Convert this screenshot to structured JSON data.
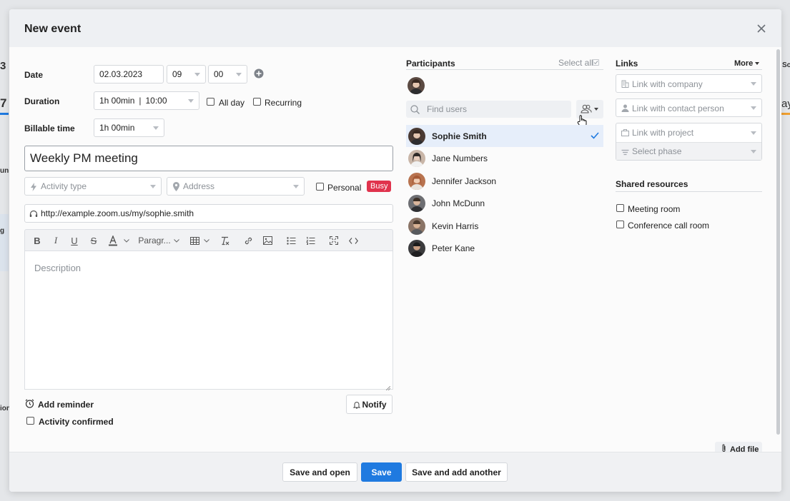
{
  "background": {
    "fragments": [
      "3",
      "7",
      "uni",
      "g",
      "ion",
      "Sc",
      "ay"
    ]
  },
  "modal": {
    "title": "New event"
  },
  "form": {
    "date_label": "Date",
    "date_value": "02.03.2023",
    "hour_value": "09",
    "minute_value": "00",
    "duration_label": "Duration",
    "duration_value": "1h 00min",
    "duration_end": "10:00",
    "all_day_label": "All day",
    "recurring_label": "Recurring",
    "billable_label": "Billable time",
    "billable_value": "1h 00min",
    "title_value": "Weekly PM meeting",
    "activity_type_placeholder": "Activity type",
    "address_placeholder": "Address",
    "personal_label": "Personal",
    "busy_badge": "Busy",
    "meeting_url": "http://example.zoom.us/my/sophie.smith",
    "paragraph_label": "Paragr...",
    "description_placeholder": "Description",
    "add_reminder_label": "Add reminder",
    "activity_confirmed_label": "Activity confirmed",
    "notify_label": "Notify"
  },
  "participants": {
    "title": "Participants",
    "select_all": "Select all",
    "search_placeholder": "Find users",
    "people": [
      {
        "name": "Sophie Smith",
        "selected": true,
        "color": "#4a3a33"
      },
      {
        "name": "Jane Numbers",
        "selected": false,
        "color": "#c9b6a8"
      },
      {
        "name": "Jennifer Jackson",
        "selected": false,
        "color": "#b8734f"
      },
      {
        "name": "John McDunn",
        "selected": false,
        "color": "#6d6e72"
      },
      {
        "name": "Kevin Harris",
        "selected": false,
        "color": "#8a7466"
      },
      {
        "name": "Peter Kane",
        "selected": false,
        "color": "#3b3b3d"
      }
    ]
  },
  "links": {
    "title": "Links",
    "more_label": "More",
    "company_placeholder": "Link with company",
    "contact_placeholder": "Link with contact person",
    "project_placeholder": "Link with project",
    "phase_placeholder": "Select phase"
  },
  "shared_resources": {
    "title": "Shared resources",
    "items": [
      "Meeting room",
      "Conference call room"
    ]
  },
  "add_file_label": "Add file",
  "footer": {
    "save_and_open": "Save and open",
    "save": "Save",
    "save_and_add_another": "Save and add another"
  },
  "colors": {
    "primary": "#1f7ae0",
    "busy": "#e0334d",
    "selected_row": "#e6eefa"
  }
}
